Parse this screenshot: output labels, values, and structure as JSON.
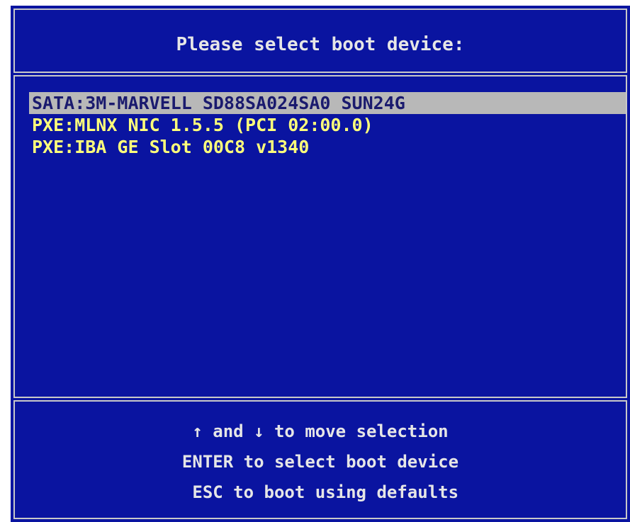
{
  "title": "Please select boot device:",
  "boot_devices": [
    {
      "label": "SATA:3M-MARVELL SD88SA024SA0 SUN24G",
      "selected": true
    },
    {
      "label": "PXE:MLNX NIC 1.5.5 (PCI 02:00.0)",
      "selected": false
    },
    {
      "label": "PXE:IBA GE Slot 00C8 v1340",
      "selected": false
    }
  ],
  "help": {
    "line1": "↑ and ↓ to move selection",
    "line2": "ENTER to select boot device",
    "line3": " ESC to boot using defaults"
  },
  "colors": {
    "background": "#0a14a0",
    "item_text": "#ffff7a",
    "selected_bg": "#b8b8b8",
    "selected_text": "#1a1a6e",
    "frame": "#c8c8c8"
  }
}
